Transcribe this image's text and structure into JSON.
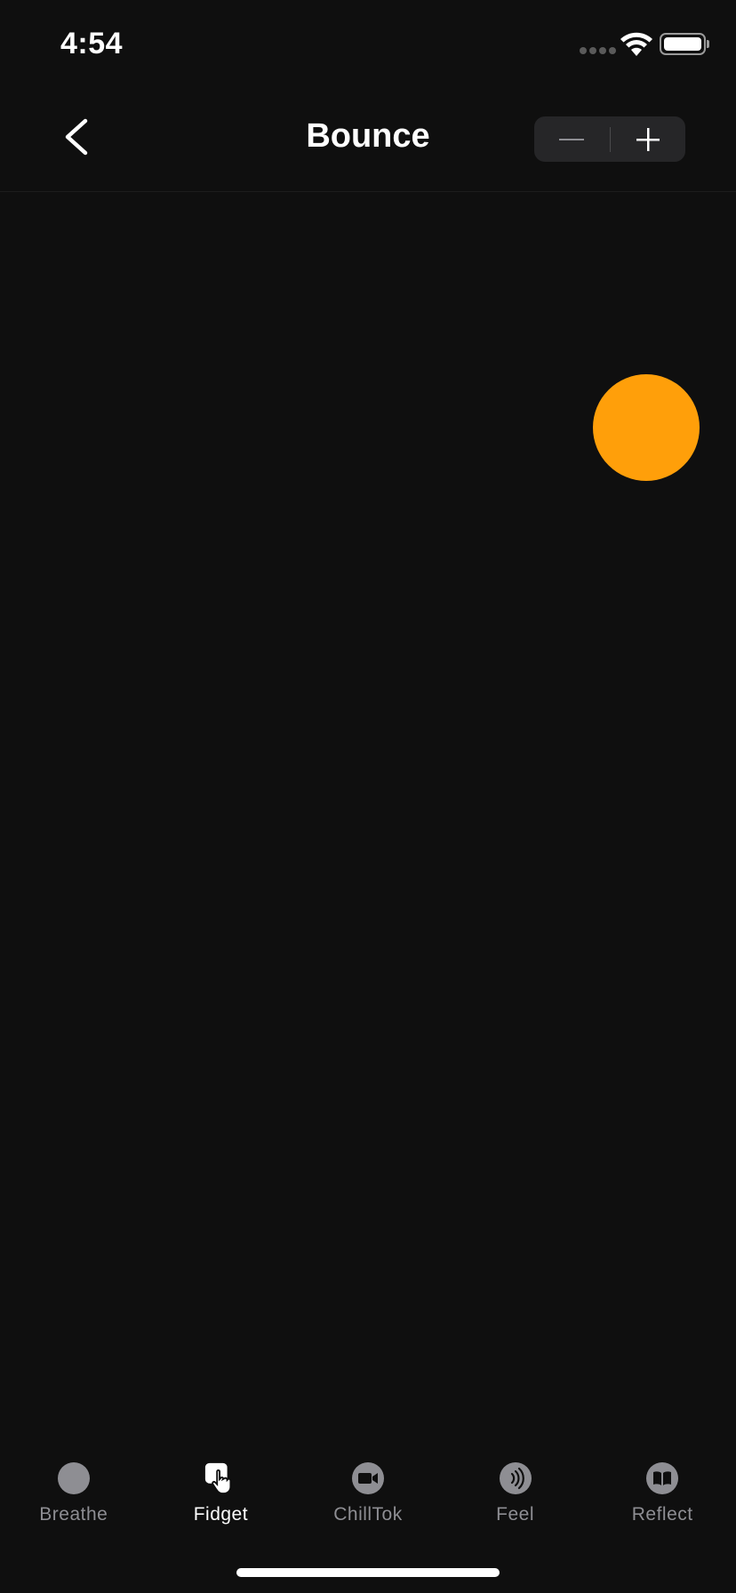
{
  "status": {
    "time": "4:54"
  },
  "nav": {
    "title": "Bounce",
    "back_icon": "chevron-left-icon",
    "stepper": {
      "decrement_icon": "minus-icon",
      "increment_icon": "plus-icon"
    }
  },
  "ball": {
    "color": "#ff9f0a"
  },
  "tabs": [
    {
      "label": "Breathe",
      "icon": "circle-icon",
      "active": false
    },
    {
      "label": "Fidget",
      "icon": "hand-pointer-icon",
      "active": true
    },
    {
      "label": "ChillTok",
      "icon": "video-camera-icon",
      "active": false
    },
    {
      "label": "Feel",
      "icon": "sound-waves-icon",
      "active": false
    },
    {
      "label": "Reflect",
      "icon": "book-icon",
      "active": false
    }
  ],
  "colors": {
    "background": "#0f0f0f",
    "accent": "#ff9f0a",
    "inactive": "#8e8e93",
    "active": "#ffffff"
  }
}
